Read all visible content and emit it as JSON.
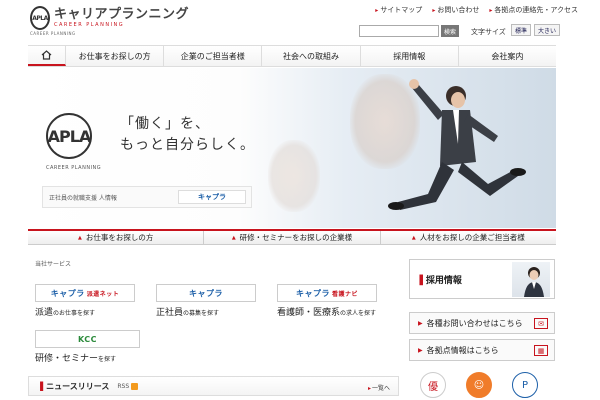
{
  "header": {
    "logo_mark": "APLA",
    "logo_jp": "キャリアプランニング",
    "logo_en": "CAREER PLANNING",
    "logo_sub": "CAREER PLANNING",
    "top_links": [
      "サイトマップ",
      "お問い合わせ",
      "各拠点の連絡先・アクセス"
    ],
    "search": {
      "placeholder": "",
      "button": "検索"
    },
    "font_size_label": "文字サイズ",
    "font_size_options": [
      "標準",
      "大きい"
    ]
  },
  "nav": {
    "home_icon": "home-icon",
    "items": [
      "お仕事をお探しの方",
      "企業のご担当者様",
      "社会への取組み",
      "採用情報",
      "会社案内"
    ]
  },
  "hero": {
    "mark": "APLA",
    "mark_sub": "CAREER PLANNING",
    "copy1": "「働く」を、",
    "copy2": "もっと自分らしく。",
    "box_text": "正社員の就職支援  人情報",
    "box_logo": "キャプラ"
  },
  "subnav": {
    "items": [
      "お仕事をお探しの方",
      "研修・セミナーをお探しの企業様",
      "人材をお探しの企業ご担当者様"
    ]
  },
  "services": {
    "label": "当社サービス",
    "items": [
      {
        "logo": "キャプラ",
        "tag": "派遣ネット",
        "main": "派遣",
        "sub": "のお仕事を探す"
      },
      {
        "logo": "キャプラ",
        "tag": "",
        "main": "正社員",
        "sub": "の募集を探す"
      },
      {
        "logo": "キャプラ",
        "tag": "看護ナビ",
        "main": "看護師・医療系",
        "sub": "の求人を探す"
      },
      {
        "logo": "KCC",
        "tag": "",
        "main": "研修・セミナー",
        "sub": "を探す"
      }
    ]
  },
  "right": {
    "recruit": "採用情報",
    "contact": "各種お問い合わせはこちら",
    "offices": "各拠点情報はこちら"
  },
  "news": {
    "title": "ニュースリリース",
    "rss": "RSS",
    "more": "一覧へ"
  },
  "colors": {
    "accent": "#c8141e",
    "brand_blue": "#1c5fa8"
  }
}
